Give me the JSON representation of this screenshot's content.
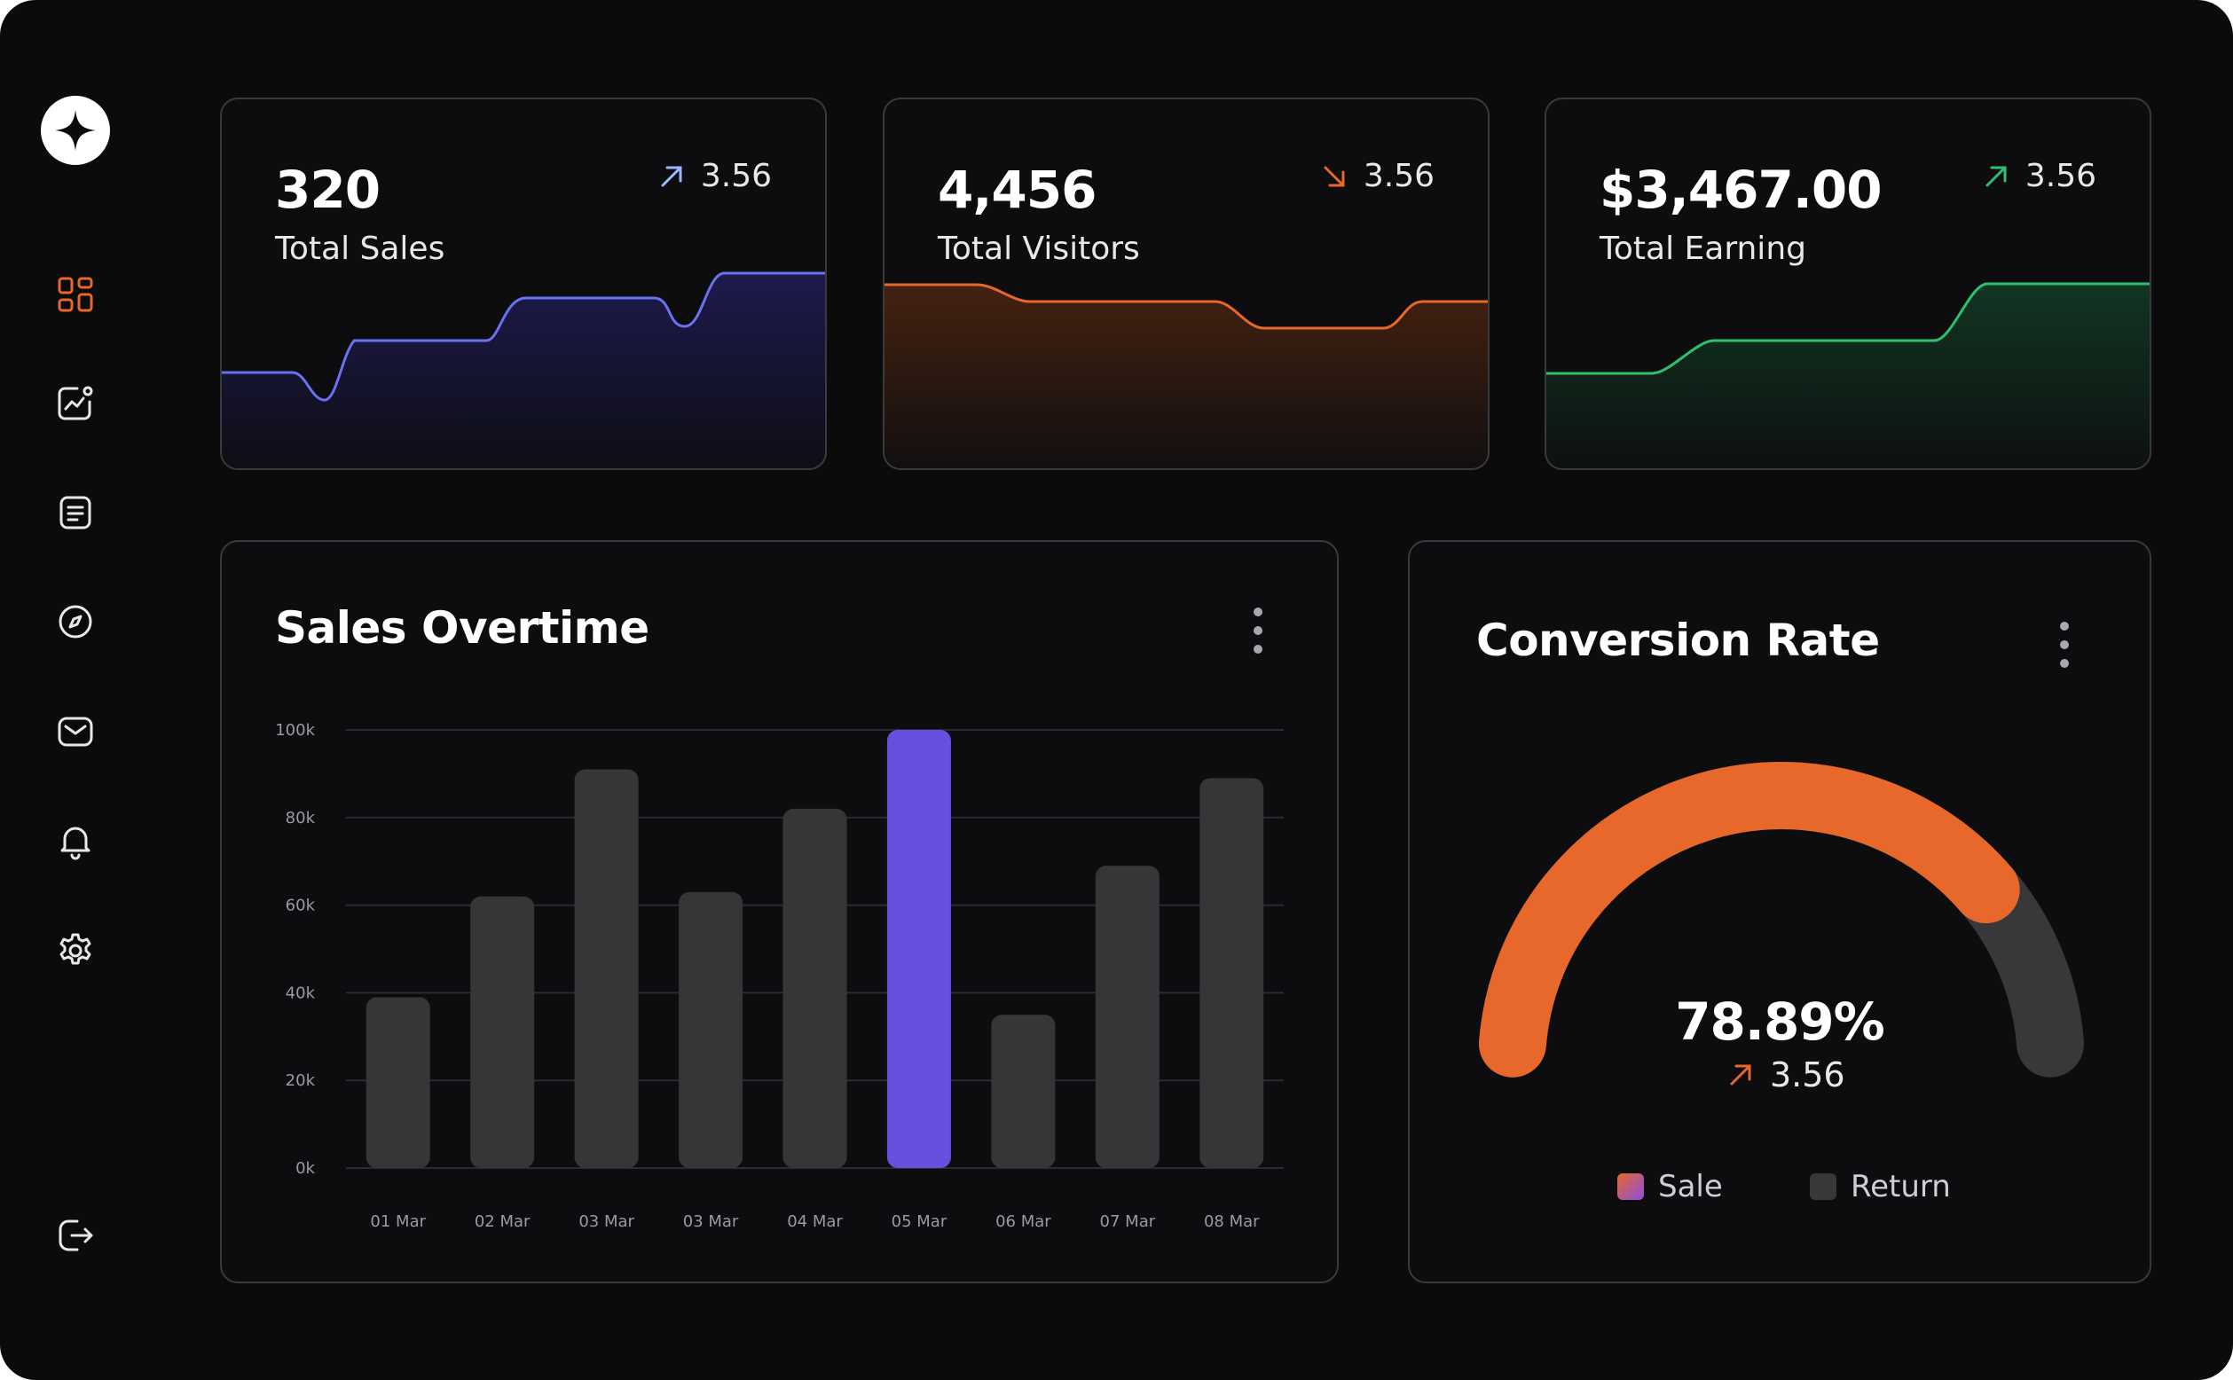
{
  "sidebar": {
    "logo_icon": "sparkle-icon",
    "items": [
      {
        "icon": "dashboard-grid-icon",
        "active": true
      },
      {
        "icon": "analytics-chart-icon",
        "active": false
      },
      {
        "icon": "document-list-icon",
        "active": false
      },
      {
        "icon": "compass-icon",
        "active": false
      },
      {
        "icon": "mail-icon",
        "active": false
      },
      {
        "icon": "bell-icon",
        "active": false
      },
      {
        "icon": "settings-gear-icon",
        "active": false
      }
    ],
    "logout_icon": "logout-icon",
    "accent": "#e8672b"
  },
  "stats": [
    {
      "value": "320",
      "label": "Total Sales",
      "trend": "3.56",
      "direction": "up",
      "color": "#6b72f0",
      "trend_color": "#9bb8ff",
      "series": [
        40,
        40,
        28,
        60,
        60,
        80,
        80,
        60,
        85,
        85
      ]
    },
    {
      "value": "4,456",
      "label": "Total Visitors",
      "trend": "3.56",
      "direction": "down",
      "color": "#e8672b",
      "trend_color": "#e8672b",
      "series": [
        85,
        85,
        75,
        75,
        75,
        65,
        65,
        65,
        75
      ]
    },
    {
      "value": "$3,467.00",
      "label": "Total Earning",
      "trend": "3.56",
      "direction": "up",
      "color": "#2fbf71",
      "trend_color": "#2fbf71",
      "series": [
        40,
        40,
        60,
        60,
        60,
        80,
        80,
        80
      ]
    }
  ],
  "sales_chart": {
    "title": "Sales Overtime",
    "menu_icon": "more-vertical-icon"
  },
  "chart_data": {
    "type": "bar",
    "categories": [
      "01 Mar",
      "02 Mar",
      "03 Mar",
      "03 Mar",
      "04 Mar",
      "05 Mar",
      "06 Mar",
      "07 Mar",
      "08 Mar"
    ],
    "values": [
      39,
      62,
      91,
      63,
      82,
      100,
      35,
      69,
      89
    ],
    "highlight_index": 5,
    "yticks": [
      "0k",
      "20k",
      "40k",
      "60k",
      "80k",
      "100k"
    ],
    "ylim": [
      0,
      100
    ],
    "units": "k",
    "grid": true,
    "colors": {
      "bar": "#363639",
      "highlight": "#6650e0"
    }
  },
  "conversion": {
    "title": "Conversion Rate",
    "menu_icon": "more-vertical-icon",
    "value": "78.89%",
    "percent": 78.89,
    "trend": "3.56",
    "legend": [
      {
        "label": "Sale",
        "color": "#e8672b"
      },
      {
        "label": "Return",
        "color": "#38383b"
      }
    ]
  }
}
